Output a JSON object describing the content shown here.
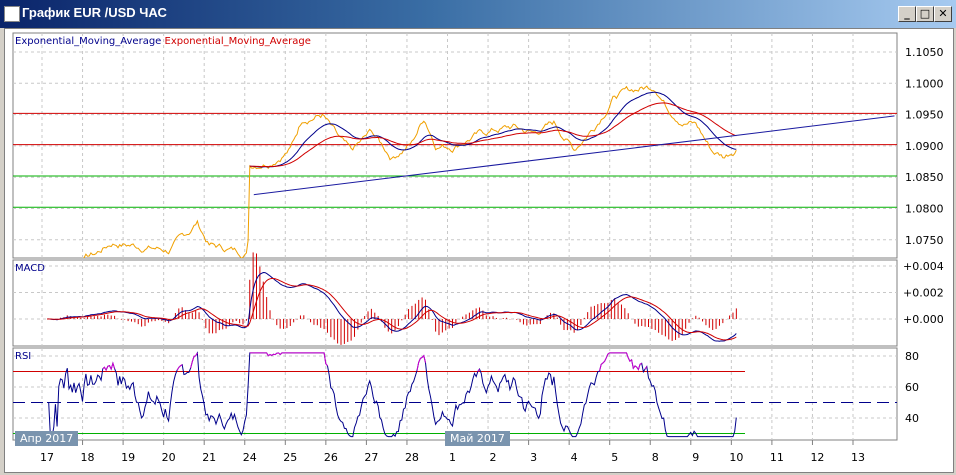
{
  "window": {
    "title": "График EUR /USD  ЧАС",
    "min": "_",
    "max": "□",
    "close": "✕"
  },
  "colors": {
    "price": "#f0a000",
    "ema_fast": "#00008b",
    "ema_slow": "#d00000",
    "resistance": "#d00000",
    "support": "#00b000",
    "trend": "#1a1aa0",
    "rsi_over": "#d000d0"
  },
  "legend": {
    "ema1": "Exponential_Moving_Average",
    "ema2": "Exponential_Moving_Average"
  },
  "panels": {
    "macd": "MACD",
    "rsi": "RSI"
  },
  "badges": {
    "apr": "Апр 2017",
    "may": "Май 2017"
  },
  "chart_data": {
    "type": "line",
    "price_axis": {
      "ticks": [
        "1.1050",
        "1.1000",
        "1.0950",
        "1.0900",
        "1.0850",
        "1.0800",
        "1.0750"
      ],
      "range": [
        1.0725,
        1.108
      ]
    },
    "macd_axis": {
      "ticks": [
        "+0.004",
        "+0.002",
        "+0.000"
      ]
    },
    "rsi_axis": {
      "ticks": [
        "80",
        "60",
        "40"
      ],
      "levels": [
        70,
        50,
        30
      ]
    },
    "x_ticks": [
      "17",
      "18",
      "19",
      "20",
      "21",
      "24",
      "25",
      "26",
      "27",
      "28",
      "1",
      "2",
      "3",
      "4",
      "5",
      "8",
      "9",
      "10",
      "11",
      "12",
      "13"
    ],
    "price_anchors": [
      [
        0,
        1.0712
      ],
      [
        1.2,
        1.0728
      ],
      [
        1.6,
        1.0745
      ],
      [
        2,
        1.0742
      ],
      [
        2.5,
        1.0738
      ],
      [
        3,
        1.0733
      ],
      [
        3.5,
        1.0762
      ],
      [
        3.7,
        1.0778
      ],
      [
        4,
        1.0742
      ],
      [
        4.95,
        1.0728
      ],
      [
        5,
        1.087
      ],
      [
        5.5,
        1.0876
      ],
      [
        6,
        1.0895
      ],
      [
        6.3,
        1.0945
      ],
      [
        6.8,
        1.095
      ],
      [
        7.2,
        1.091
      ],
      [
        7.5,
        1.0888
      ],
      [
        8,
        1.0922
      ],
      [
        8.5,
        1.0882
      ],
      [
        9,
        1.0905
      ],
      [
        9.3,
        1.0945
      ],
      [
        9.6,
        1.0902
      ],
      [
        10,
        1.09
      ],
      [
        10.5,
        1.0915
      ],
      [
        11,
        1.0925
      ],
      [
        11.5,
        1.093
      ],
      [
        12,
        1.092
      ],
      [
        12.5,
        1.0936
      ],
      [
        13,
        1.0895
      ],
      [
        13.5,
        1.0932
      ],
      [
        14,
        1.098
      ],
      [
        14.5,
        1.099
      ],
      [
        15,
        1.0996
      ],
      [
        15.3,
        1.0962
      ],
      [
        15.7,
        1.094
      ],
      [
        16,
        1.0935
      ],
      [
        16.4,
        1.0892
      ],
      [
        16.7,
        1.0883
      ],
      [
        17,
        1.0897
      ]
    ],
    "hlines": [
      {
        "price": 1.0952,
        "kind": "resistance"
      },
      {
        "price": 1.0902,
        "kind": "resistance"
      },
      {
        "price": 1.0852,
        "kind": "support"
      },
      {
        "price": 1.0802,
        "kind": "support"
      }
    ],
    "trendline": [
      [
        5.1,
        1.0822
      ],
      [
        20.9,
        1.0948
      ]
    ]
  }
}
